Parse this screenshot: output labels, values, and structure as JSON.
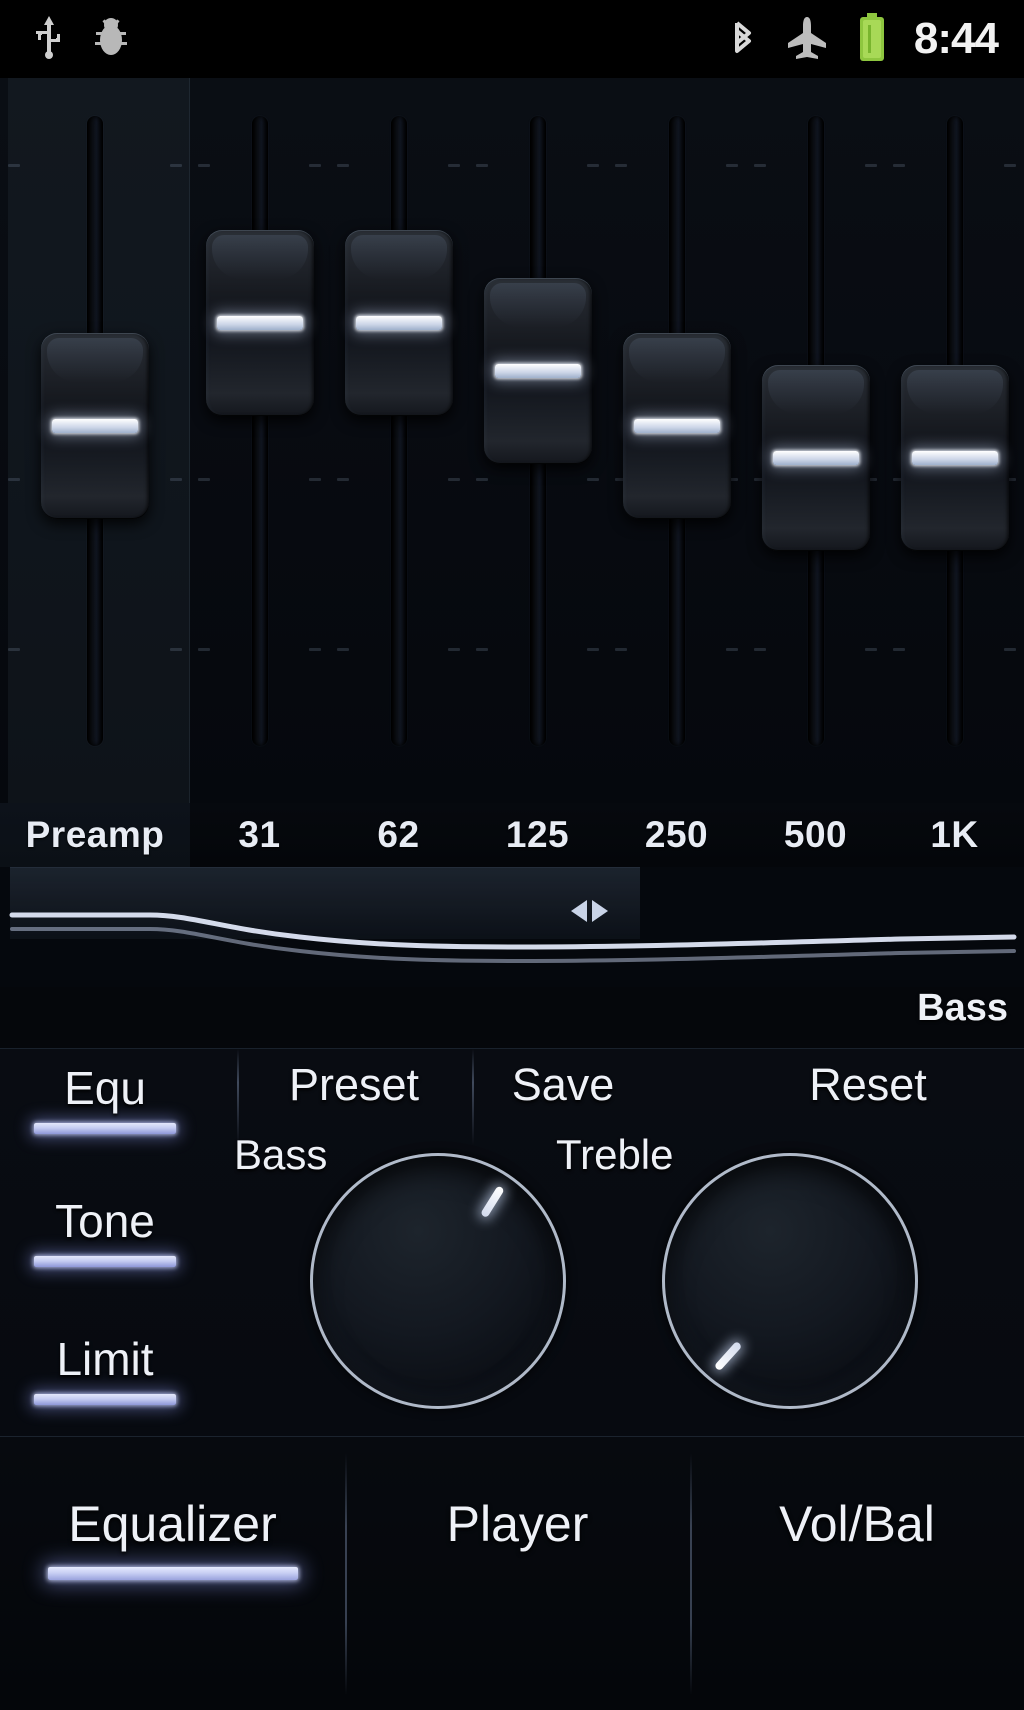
{
  "statusbar": {
    "time": "8:44",
    "left_icons": [
      "usb-icon",
      "debug-bug-icon"
    ],
    "right_icons": [
      "bluetooth-icon",
      "airplane-mode-icon",
      "battery-icon"
    ],
    "battery_color": "#8ec63f"
  },
  "equalizer": {
    "bands": [
      {
        "label": "Preamp",
        "position_pct": 50,
        "highlighted": true
      },
      {
        "label": "31",
        "position_pct": 82,
        "highlighted": false
      },
      {
        "label": "62",
        "position_pct": 82,
        "highlighted": false
      },
      {
        "label": "125",
        "position_pct": 68,
        "highlighted": false
      },
      {
        "label": "250",
        "position_pct": 50,
        "highlighted": false
      },
      {
        "label": "500",
        "position_pct": 37,
        "highlighted": false
      },
      {
        "label": "1K",
        "position_pct": 37,
        "highlighted": false
      }
    ]
  },
  "response_curve": {
    "caption": "Bass",
    "handle_icon": "left-right-drag-arrows-icon"
  },
  "actions": {
    "equ": "Equ",
    "preset": "Preset",
    "save": "Save",
    "reset": "Reset"
  },
  "modes": {
    "equ": "Equ",
    "tone": "Tone",
    "limit": "Limit"
  },
  "knobs": {
    "bass": {
      "label": "Bass",
      "angle_deg": 40
    },
    "treble": {
      "label": "Treble",
      "angle_deg": -130
    }
  },
  "tabs": {
    "equalizer": "Equalizer",
    "player": "Player",
    "volbal": "Vol/Bal",
    "active": "Equalizer"
  },
  "colors": {
    "accent": "#c6cdf2",
    "background": "#05080d",
    "text": "#eef1f7",
    "battery": "#8ec63f"
  }
}
